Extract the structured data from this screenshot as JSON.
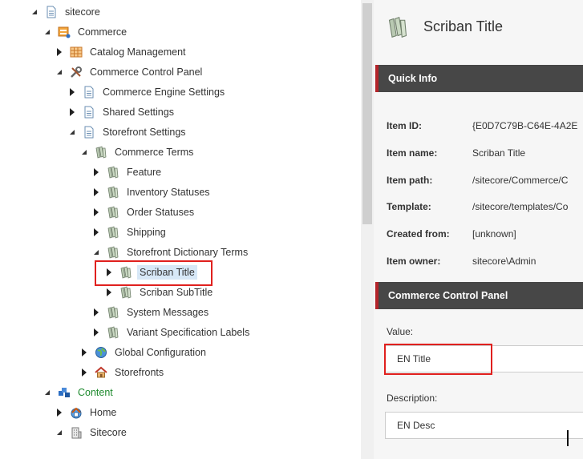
{
  "tree": {
    "nodes": [
      {
        "label": "sitecore",
        "icon": "document-icon",
        "expanded": true
      },
      {
        "label": "Commerce",
        "icon": "commerce-icon",
        "expanded": true
      },
      {
        "label": "Catalog Management",
        "icon": "grid-icon",
        "expanded": false
      },
      {
        "label": "Commerce Control Panel",
        "icon": "tools-icon",
        "expanded": true
      },
      {
        "label": "Commerce Engine Settings",
        "icon": "document-icon",
        "expanded": false
      },
      {
        "label": "Shared Settings",
        "icon": "document-icon",
        "expanded": false
      },
      {
        "label": "Storefront Settings",
        "icon": "document-icon",
        "expanded": true
      },
      {
        "label": "Commerce Terms",
        "icon": "tags-icon",
        "expanded": true
      },
      {
        "label": "Feature",
        "icon": "tags-icon",
        "expanded": false
      },
      {
        "label": "Inventory Statuses",
        "icon": "tags-icon",
        "expanded": false
      },
      {
        "label": "Order Statuses",
        "icon": "tags-icon",
        "expanded": false
      },
      {
        "label": "Shipping",
        "icon": "tags-icon",
        "expanded": false
      },
      {
        "label": "Storefront Dictionary Terms",
        "icon": "tags-icon",
        "expanded": true
      },
      {
        "label": "Scriban Title",
        "icon": "tags-icon",
        "expanded": false,
        "selected": true
      },
      {
        "label": "Scriban SubTitle",
        "icon": "tags-icon",
        "expanded": false
      },
      {
        "label": "System Messages",
        "icon": "tags-icon",
        "expanded": false
      },
      {
        "label": "Variant Specification Labels",
        "icon": "tags-icon",
        "expanded": false
      },
      {
        "label": "Global Configuration",
        "icon": "globe-icon",
        "expanded": false
      },
      {
        "label": "Storefronts",
        "icon": "home-icon",
        "expanded": false
      },
      {
        "label": "Content",
        "icon": "content-icon",
        "expanded": true
      },
      {
        "label": "Home",
        "icon": "home-globe-icon",
        "expanded": false
      },
      {
        "label": "Sitecore",
        "icon": "building-icon",
        "expanded": true
      }
    ]
  },
  "editor": {
    "title": "Scriban Title",
    "title_icon": "tags-icon",
    "quick_info": {
      "heading": "Quick Info",
      "rows": [
        {
          "key": "Item ID:",
          "value": "{E0D7C79B-C64E-4A2E"
        },
        {
          "key": "Item name:",
          "value": "Scriban Title"
        },
        {
          "key": "Item path:",
          "value": "/sitecore/Commerce/C"
        },
        {
          "key": "Template:",
          "value": "/sitecore/templates/Co"
        },
        {
          "key": "Created from:",
          "value": "[unknown]"
        },
        {
          "key": "Item owner:",
          "value": "sitecore\\Admin"
        }
      ]
    },
    "panel": {
      "heading": "Commerce Control Panel",
      "value_label": "Value:",
      "value": "EN Title",
      "description_label": "Description:",
      "description": "EN Desc"
    }
  },
  "colors": {
    "section_bg": "#474747",
    "section_accent": "#b3242a",
    "highlight": "#e0201e",
    "selected_bg": "#d7e8f7",
    "content_green": "#1e8a2e"
  }
}
